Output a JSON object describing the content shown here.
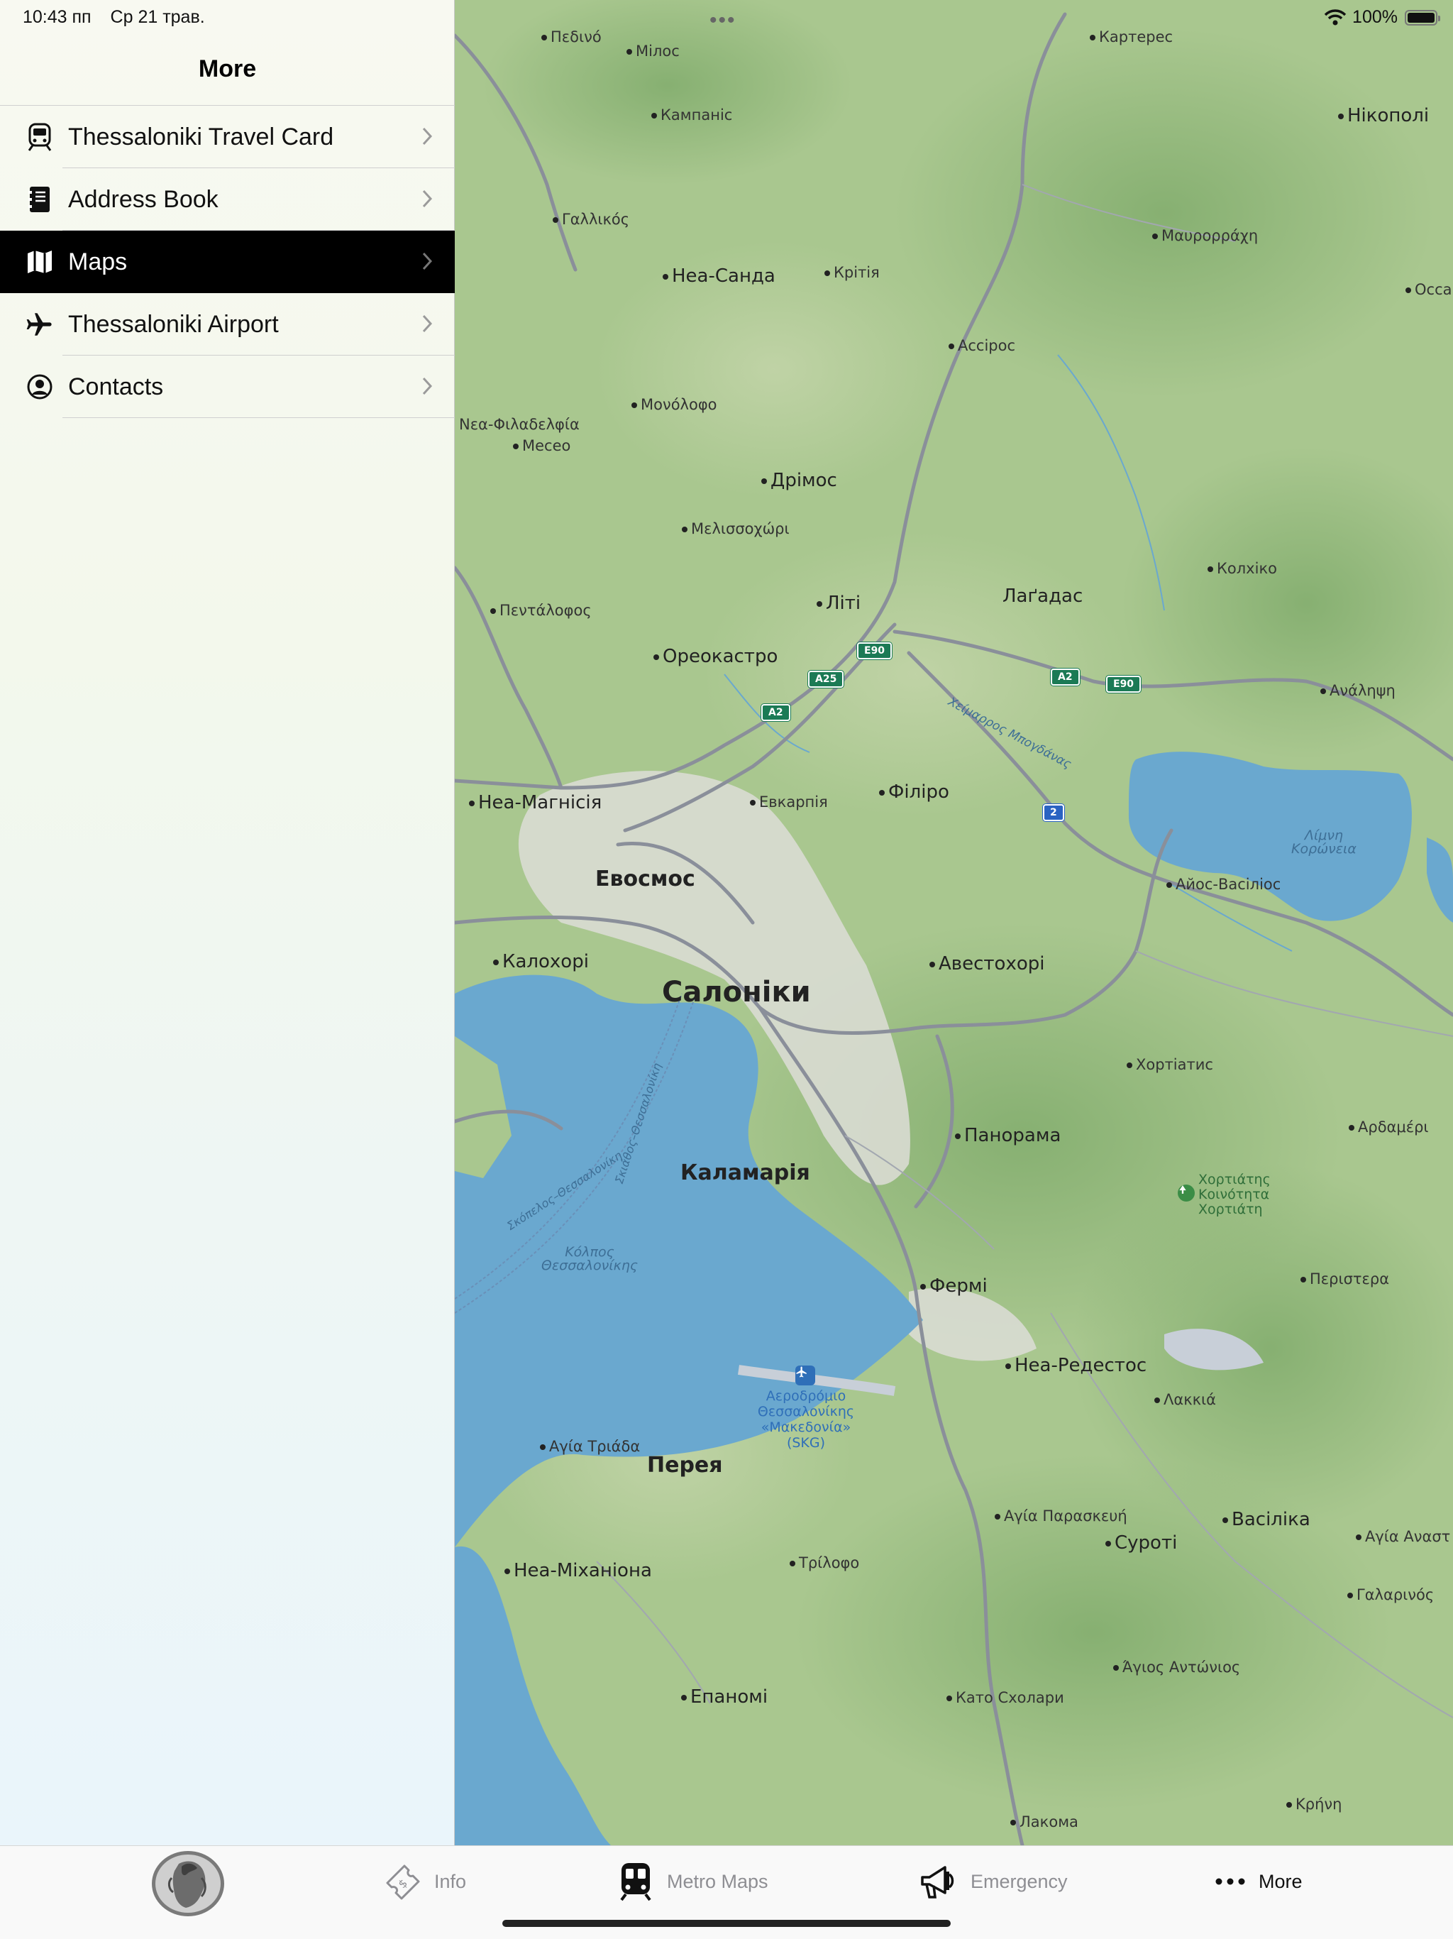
{
  "status_bar": {
    "time": "10:43 пп",
    "date": "Ср 21 трав.",
    "battery_percent": "100%",
    "battery_level": 1.0,
    "multitask_dots": "•••"
  },
  "sidebar": {
    "title": "More",
    "items": [
      {
        "label": "Thessaloniki Travel Card",
        "icon": "train-icon",
        "selected": false
      },
      {
        "label": "Address Book",
        "icon": "book-icon",
        "selected": false
      },
      {
        "label": "Maps",
        "icon": "map-icon",
        "selected": true
      },
      {
        "label": "Thessaloniki Airport",
        "icon": "airplane-icon",
        "selected": false
      },
      {
        "label": "Contacts",
        "icon": "person-circle-icon",
        "selected": false
      }
    ]
  },
  "map": {
    "places": [
      {
        "name": "Πεδινό"
      },
      {
        "name": "Мілос"
      },
      {
        "name": "Картерес"
      },
      {
        "name": "Кампаніс"
      },
      {
        "name": "Нікополі"
      },
      {
        "name": "Γαλλικός"
      },
      {
        "name": "Μαυρορράχη"
      },
      {
        "name": "Неа-Санда"
      },
      {
        "name": "Крітія"
      },
      {
        "name": "Осса"
      },
      {
        "name": "Ассірос"
      },
      {
        "name": "Μονόλοφο"
      },
      {
        "name": "Νεα-Φιλαδελφία"
      },
      {
        "name": "Месео"
      },
      {
        "name": "Дрімос"
      },
      {
        "name": "Μελισσοχώρι"
      },
      {
        "name": "Колхіко"
      },
      {
        "name": "Πεντάλοφος"
      },
      {
        "name": "Літі"
      },
      {
        "name": "Лаґадас"
      },
      {
        "name": "Ореокастро"
      },
      {
        "name": "Ανάληψη"
      },
      {
        "name": "Неа-Магнісія"
      },
      {
        "name": "Евкарпія"
      },
      {
        "name": "Філіро"
      },
      {
        "name": "Евосмос"
      },
      {
        "name": "Айос-Васіліос"
      },
      {
        "name": "Калохорі"
      },
      {
        "name": "Авестохорі"
      },
      {
        "name": "Салоніки"
      },
      {
        "name": "Хортіатис"
      },
      {
        "name": "Панорама"
      },
      {
        "name": "Αρδαμέρι"
      },
      {
        "name": "Каламарія"
      },
      {
        "name": "Περιστερα"
      },
      {
        "name": "Фермі"
      },
      {
        "name": "Неа-Редестос"
      },
      {
        "name": "Λακκιά"
      },
      {
        "name": "Αγία Τριάδα"
      },
      {
        "name": "Перея"
      },
      {
        "name": "Αγία Παρασκευή"
      },
      {
        "name": "Васіліка"
      },
      {
        "name": "Суроті"
      },
      {
        "name": "Αγία Αναστ"
      },
      {
        "name": "Неа-Міханіона"
      },
      {
        "name": "Τρίλοφο"
      },
      {
        "name": "Γαλαρινός"
      },
      {
        "name": "Άγιος Αντώνιος"
      },
      {
        "name": "Епаномі"
      },
      {
        "name": "Като Схолари"
      },
      {
        "name": "Κρήνη"
      },
      {
        "name": "Лакома"
      }
    ],
    "water_labels": [
      "Λίμνη Κορώνεια",
      "Κόλπος Θεσσαλονίκης",
      "Σκόπελος–Θεσσαλονίκη",
      "Σκιάθος–Θεσσαλονίκη",
      "Χείμαρρος Μπογδάνας"
    ],
    "airport_label": "Αεροδρόμιο Θεσσαλονίκης «Μακεδονία» (SKG)",
    "park_label": "Χορτιάτης Κοινότητα Χορτιάτη",
    "road_shields": [
      "E90",
      "A25",
      "A2",
      "A2",
      "E90",
      "2"
    ],
    "colors": {
      "land": "#a9c78f",
      "forest": "#8fba7a",
      "water": "#6aa8cf",
      "urban": "#d9dcd3",
      "road": "#8a8f9a"
    }
  },
  "tabbar": {
    "tabs": [
      {
        "label": "",
        "icon": "coin-portrait-icon"
      },
      {
        "label": "Info",
        "icon": "ticket-icon"
      },
      {
        "label": "Metro Maps",
        "icon": "metro-icon"
      },
      {
        "label": "Emergency",
        "icon": "megaphone-icon"
      },
      {
        "label": "More",
        "icon": "ellipsis-icon"
      }
    ],
    "active": "More"
  }
}
